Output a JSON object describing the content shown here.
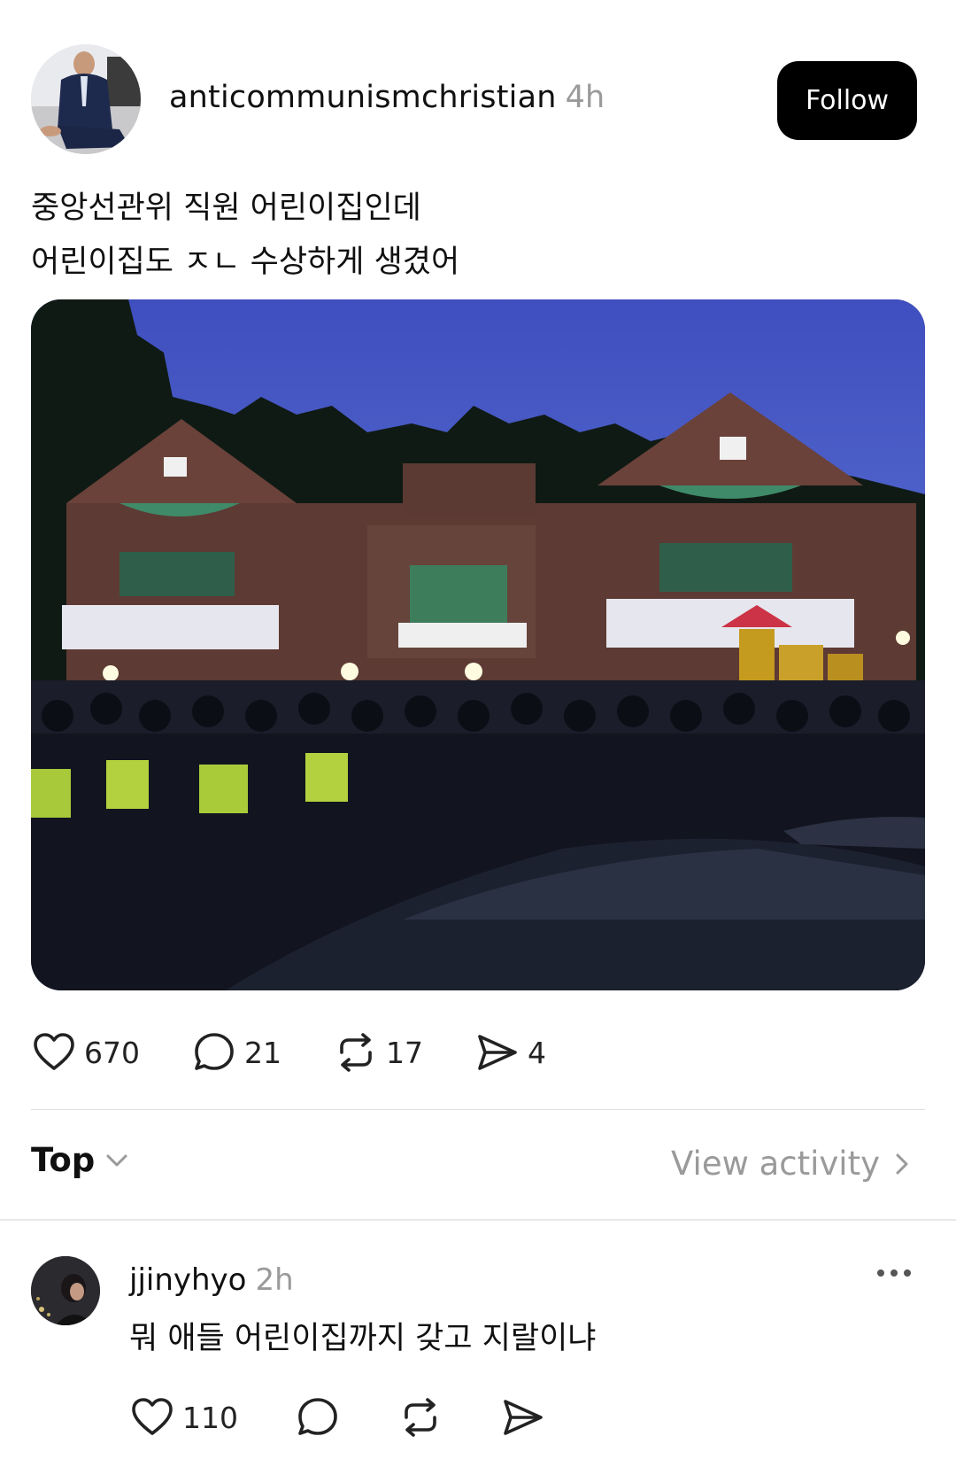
{
  "post": {
    "author": "anticommunismchristian",
    "time": "4h",
    "follow_label": "Follow",
    "text_lines": [
      "중앙선관위 직원 어린이집인데",
      "어린이집도 ㅈㄴ 수상하게 생겼어"
    ],
    "image_icon": "photo-police-at-daycare-building"
  },
  "actions": {
    "likes": "670",
    "comments": "21",
    "reposts": "17",
    "shares": "4"
  },
  "sort": {
    "label": "Top",
    "activity_label": "View activity"
  },
  "reply": {
    "author": "jjinyhyo",
    "time": "2h",
    "text": "뭐 애들 어린이집까지 갖고 지랄이냐",
    "likes": "110"
  },
  "colors": {
    "follow_bg": "#000000",
    "muted_text": "#9a9a9a",
    "divider": "#e0e0e0"
  }
}
